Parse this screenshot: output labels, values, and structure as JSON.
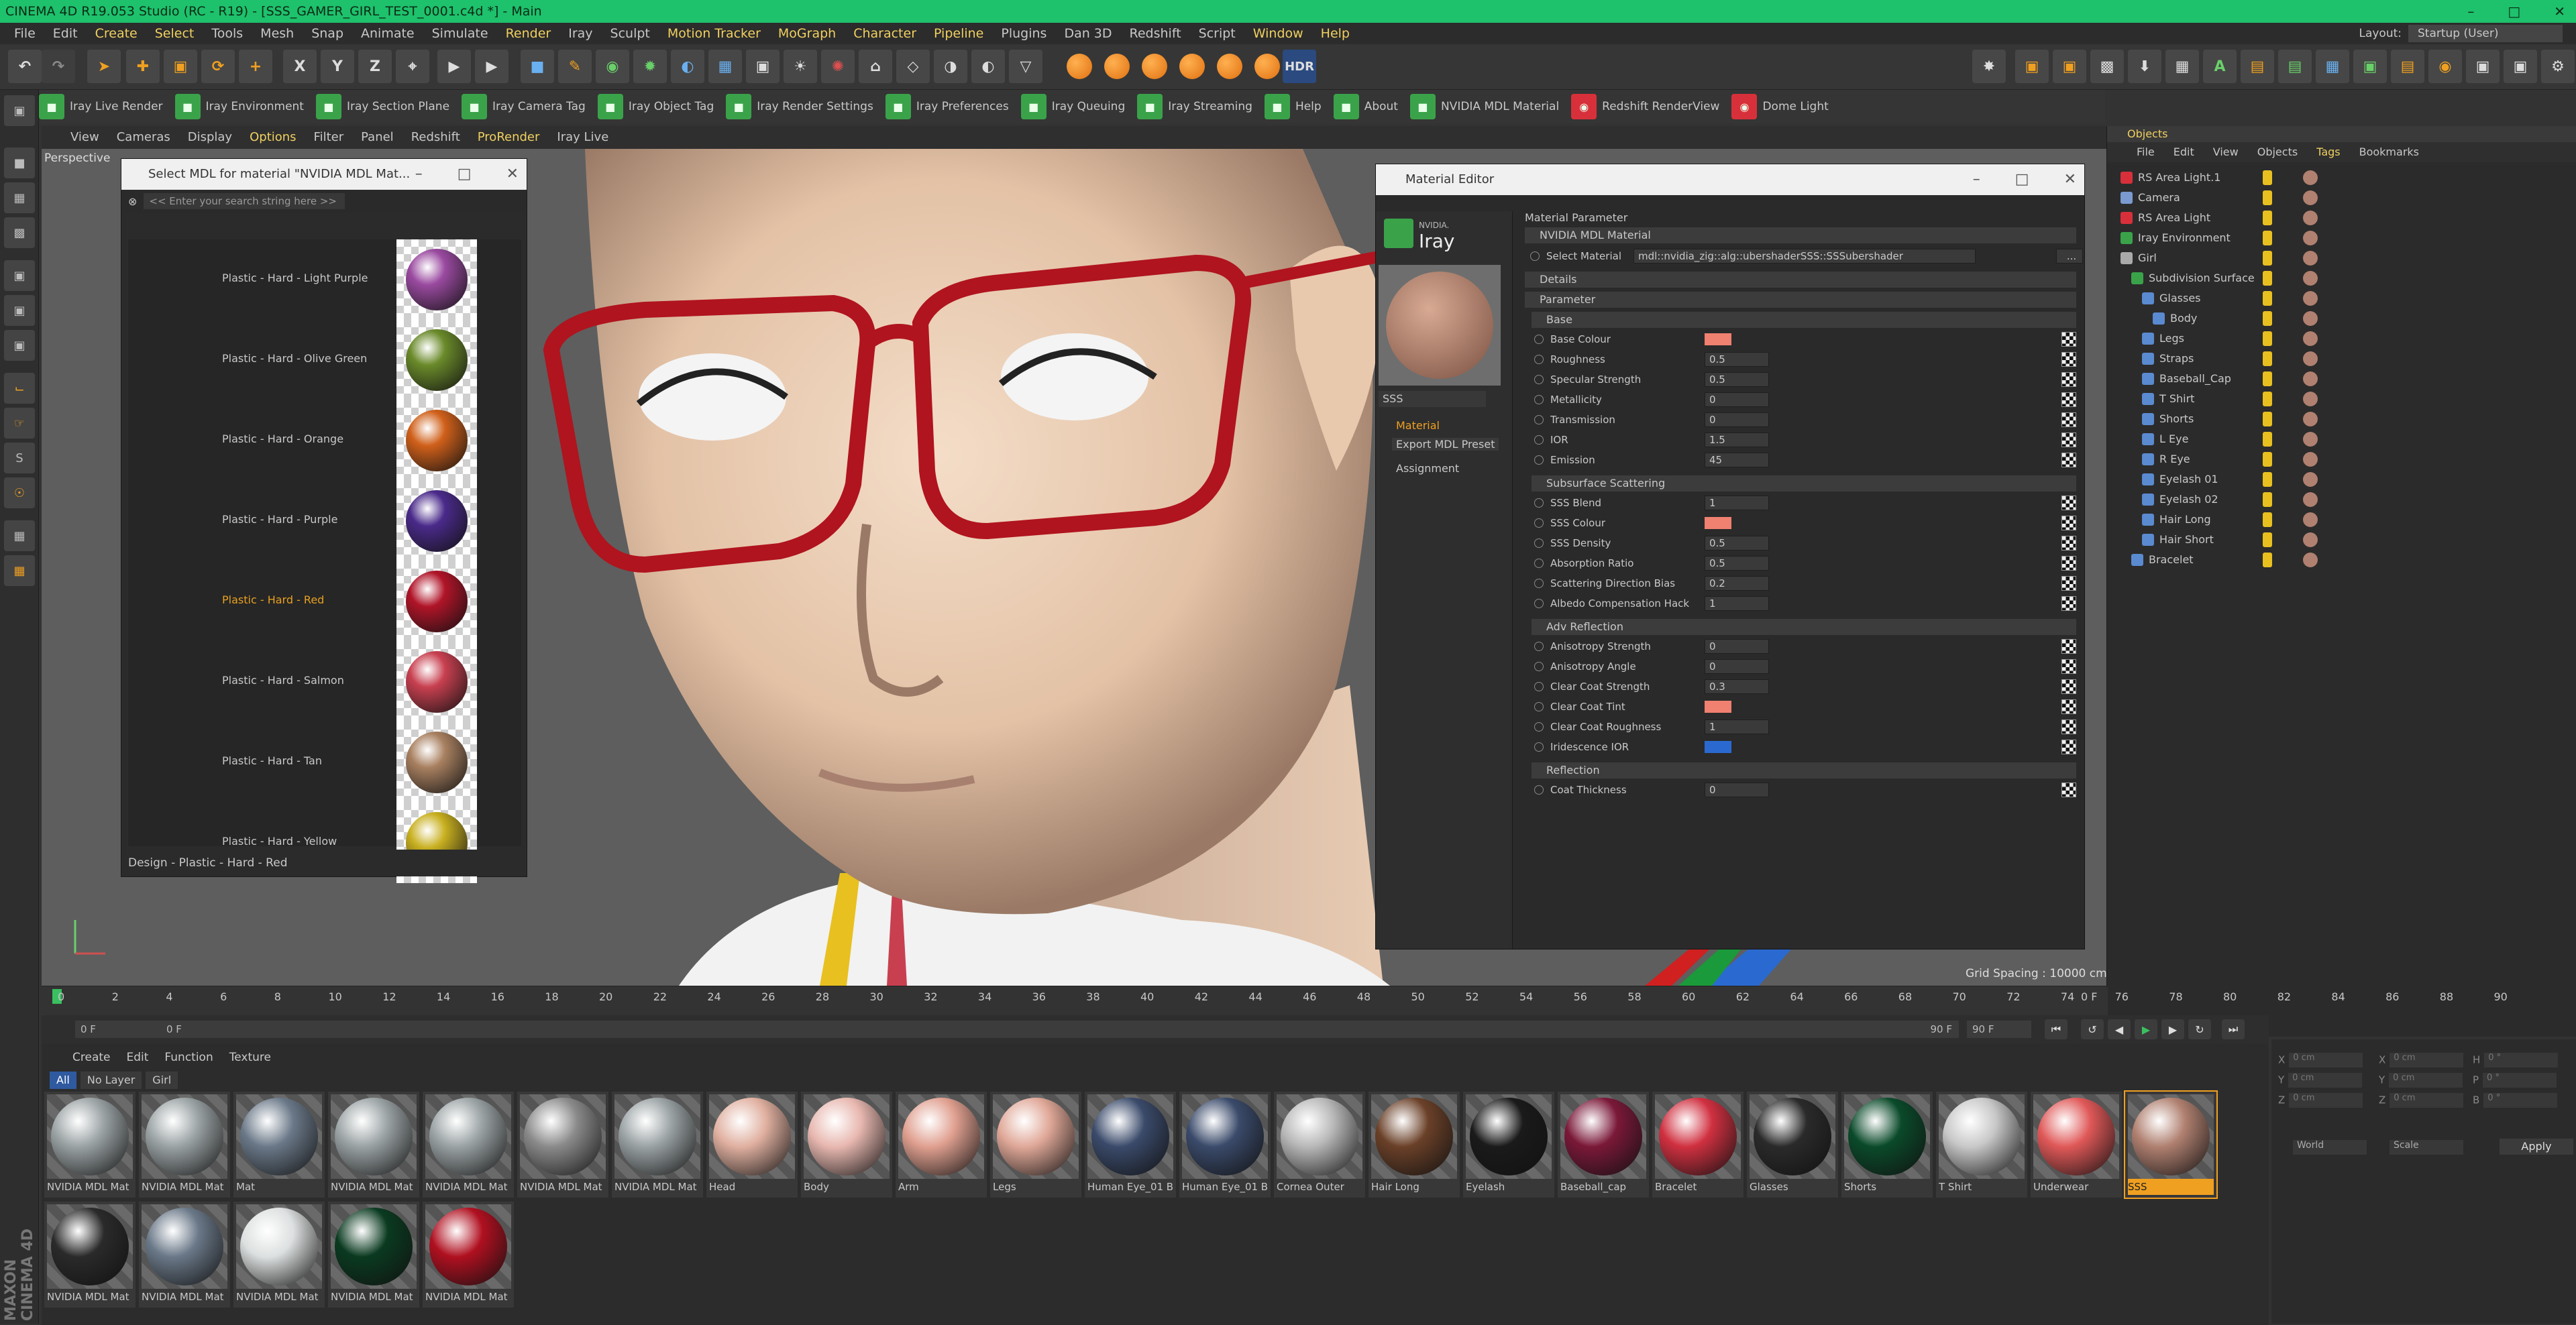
{
  "window": {
    "title": "CINEMA 4D R19.053 Studio (RC - R19) - [SSS_GAMER_GIRL_TEST_0001.c4d *] - Main"
  },
  "menubar": [
    "File",
    "Edit",
    "Create",
    "Select",
    "Tools",
    "Mesh",
    "Snap",
    "Animate",
    "Simulate",
    "Render",
    "Iray",
    "Sculpt",
    "Motion Tracker",
    "MoGraph",
    "Character",
    "Pipeline",
    "Plugins",
    "Dan 3D",
    "Redshift",
    "Script",
    "Window",
    "Help"
  ],
  "layout": {
    "label": "Layout:",
    "value": "Startup (User)"
  },
  "toolbar": {
    "hdr_label": "HDR"
  },
  "plugins": [
    {
      "label": "Iray Live Render",
      "icon": "iray-icon"
    },
    {
      "label": "Iray Environment",
      "icon": "iray-icon"
    },
    {
      "label": "Iray Section Plane",
      "icon": "iray-icon"
    },
    {
      "label": "Iray Camera Tag",
      "icon": "iray-icon"
    },
    {
      "label": "Iray Object Tag",
      "icon": "iray-icon"
    },
    {
      "label": "Iray Render Settings",
      "icon": "iray-icon"
    },
    {
      "label": "Iray Preferences",
      "icon": "iray-icon"
    },
    {
      "label": "Iray Queuing",
      "icon": "iray-icon"
    },
    {
      "label": "Iray Streaming",
      "icon": "iray-icon"
    },
    {
      "label": "Help",
      "icon": "iray-icon"
    },
    {
      "label": "About",
      "icon": "iray-icon"
    },
    {
      "label": "NVIDIA MDL Material",
      "icon": "iray-icon"
    },
    {
      "label": "Redshift RenderView",
      "icon": "redshift-icon"
    },
    {
      "label": "Dome Light",
      "icon": "redshift-icon"
    }
  ],
  "viewport": {
    "menu": [
      "View",
      "Cameras",
      "Display",
      "Options",
      "Filter",
      "Panel",
      "Redshift",
      "ProRender",
      "Iray Live"
    ],
    "label": "Perspective",
    "grid_spacing": "Grid Spacing : 10000 cm"
  },
  "mdl_browser": {
    "title": "Select MDL for material \"NVIDIA MDL Mat...",
    "search_placeholder": "<< Enter your search string here >>",
    "items": [
      {
        "label": "Plastic - Hard - Light Purple",
        "color": "#9a4aa0",
        "selected": false
      },
      {
        "label": "Plastic - Hard - Olive Green",
        "color": "#6a8a2a",
        "selected": false
      },
      {
        "label": "Plastic - Hard - Orange",
        "color": "#d0601a",
        "selected": false
      },
      {
        "label": "Plastic - Hard - Purple",
        "color": "#4a2a8a",
        "selected": false
      },
      {
        "label": "Plastic - Hard - Red",
        "color": "#b01428",
        "selected": true
      },
      {
        "label": "Plastic - Hard - Salmon",
        "color": "#c84050",
        "selected": false
      },
      {
        "label": "Plastic - Hard - Tan",
        "color": "#a88060",
        "selected": false
      },
      {
        "label": "Plastic - Hard - Yellow",
        "color": "#c8b020",
        "selected": false
      }
    ],
    "status": "Design - Plastic - Hard - Red"
  },
  "material_editor": {
    "title": "Material Editor",
    "logo_top": "NVIDIA.",
    "logo_text": "Iray",
    "material_name": "SSS",
    "channels": [
      "Material",
      "Export MDL Preset",
      "Assignment"
    ],
    "header": "Material Parameter",
    "mdl_section": "NVIDIA MDL Material",
    "select_material_label": "Select Material",
    "select_material_value": "mdl::nvidia_zig::alg::ubershaderSSS::SSSubershader",
    "browse_button": "...",
    "details_label": "Details",
    "parameter_label": "Parameter",
    "sections": [
      {
        "title": "Base",
        "params": [
          {
            "name": "Base Colour",
            "color": "#f08070"
          },
          {
            "name": "Roughness",
            "value": "0.5"
          },
          {
            "name": "Specular Strength",
            "value": "0.5"
          },
          {
            "name": "Metallicity",
            "value": "0"
          },
          {
            "name": "Transmission",
            "value": "0"
          },
          {
            "name": "IOR",
            "value": "1.5"
          },
          {
            "name": "Emission",
            "value": "45"
          }
        ]
      },
      {
        "title": "Subsurface Scattering",
        "params": [
          {
            "name": "SSS Blend",
            "value": "1"
          },
          {
            "name": "SSS Colour",
            "color": "#f08070"
          },
          {
            "name": "SSS Density",
            "value": "0.5"
          },
          {
            "name": "Absorption Ratio",
            "value": "0.5"
          },
          {
            "name": "Scattering Direction Bias",
            "value": "0.2"
          },
          {
            "name": "Albedo Compensation Hack",
            "value": "1"
          }
        ]
      },
      {
        "title": "Adv Reflection",
        "params": [
          {
            "name": "Anisotropy Strength",
            "value": "0"
          },
          {
            "name": "Anisotropy Angle",
            "value": "0"
          },
          {
            "name": "Clear Coat Strength",
            "value": "0.3"
          },
          {
            "name": "Clear Coat Tint",
            "color": "#f08070"
          },
          {
            "name": "Clear Coat Roughness",
            "value": "1"
          },
          {
            "name": "Iridescence IOR",
            "color": "#2a6ad0"
          }
        ]
      },
      {
        "title": "Reflection",
        "params": [
          {
            "name": "Coat Thickness",
            "value": "0"
          }
        ]
      }
    ]
  },
  "objects_panel": {
    "tab": "Objects",
    "menu": [
      "File",
      "Edit",
      "View",
      "Objects",
      "Tags",
      "Bookmarks"
    ],
    "items": [
      {
        "label": "RS Area Light.1",
        "depth": 0,
        "icon_color": "#d8303a"
      },
      {
        "label": "Camera",
        "depth": 0,
        "icon_color": "#7a9ad0"
      },
      {
        "label": "RS Area Light",
        "depth": 0,
        "icon_color": "#d8303a"
      },
      {
        "label": "Iray Environment",
        "depth": 0,
        "icon_color": "#3aa34a"
      },
      {
        "label": "Girl",
        "depth": 0,
        "icon_color": "#aaaaaa"
      },
      {
        "label": "Subdivision Surface",
        "depth": 1,
        "icon_color": "#3aa34a"
      },
      {
        "label": "Glasses",
        "depth": 2,
        "icon_color": "#5a8ad0"
      },
      {
        "label": "Body",
        "depth": 3,
        "icon_color": "#5a8ad0"
      },
      {
        "label": "Legs",
        "depth": 2,
        "icon_color": "#5a8ad0"
      },
      {
        "label": "Straps",
        "depth": 2,
        "icon_color": "#5a8ad0"
      },
      {
        "label": "Baseball_Cap",
        "depth": 2,
        "icon_color": "#5a8ad0"
      },
      {
        "label": "T Shirt",
        "depth": 2,
        "icon_color": "#5a8ad0"
      },
      {
        "label": "Shorts",
        "depth": 2,
        "icon_color": "#5a8ad0"
      },
      {
        "label": "L Eye",
        "depth": 2,
        "icon_color": "#5a8ad0"
      },
      {
        "label": "R Eye",
        "depth": 2,
        "icon_color": "#5a8ad0"
      },
      {
        "label": "Eyelash 01",
        "depth": 2,
        "icon_color": "#5a8ad0"
      },
      {
        "label": "Eyelash 02",
        "depth": 2,
        "icon_color": "#5a8ad0"
      },
      {
        "label": "Hair Long",
        "depth": 2,
        "icon_color": "#5a8ad0"
      },
      {
        "label": "Hair Short",
        "depth": 2,
        "icon_color": "#5a8ad0"
      },
      {
        "label": "Bracelet",
        "depth": 1,
        "icon_color": "#5a8ad0"
      }
    ]
  },
  "coordinates": {
    "rows": [
      {
        "a": "X",
        "av": "0 cm",
        "b": "X",
        "bv": "0 cm",
        "c": "H",
        "cv": "0 °"
      },
      {
        "a": "Y",
        "av": "0 cm",
        "b": "Y",
        "bv": "0 cm",
        "c": "P",
        "cv": "0 °"
      },
      {
        "a": "Z",
        "av": "0 cm",
        "b": "Z",
        "bv": "0 cm",
        "c": "B",
        "cv": "0 °"
      }
    ],
    "world": "World",
    "scale": "Scale",
    "apply": "Apply"
  },
  "timeline": {
    "ticks": [
      "0",
      "2",
      "4",
      "6",
      "8",
      "10",
      "12",
      "14",
      "16",
      "18",
      "20",
      "22",
      "24",
      "26",
      "28",
      "30",
      "32",
      "34",
      "36",
      "38",
      "40",
      "42",
      "44",
      "46",
      "48",
      "50",
      "52",
      "54",
      "56",
      "58",
      "60",
      "62",
      "64",
      "66",
      "68",
      "70",
      "72",
      "74",
      "76",
      "78",
      "80",
      "82",
      "84",
      "86",
      "88",
      "90"
    ],
    "end_label": "0 F",
    "current_frame": "0 F",
    "start_field": "0 F",
    "range_end": "90 F",
    "end_field": "90 F"
  },
  "material_manager": {
    "menu": [
      "Create",
      "Edit",
      "Function",
      "Texture"
    ],
    "filters": [
      "All",
      "No Layer",
      "Girl"
    ],
    "materials": [
      {
        "name": "NVIDIA MDL Mat",
        "color": "#9aa2a4"
      },
      {
        "name": "NVIDIA MDL Mat",
        "color": "#9aa2a4"
      },
      {
        "name": "Mat",
        "color": "#6a7888"
      },
      {
        "name": "NVIDIA MDL Mat",
        "color": "#9aa2a4"
      },
      {
        "name": "NVIDIA MDL Mat",
        "color": "#9aa2a4"
      },
      {
        "name": "NVIDIA MDL Mat",
        "color": "#8a8a8a"
      },
      {
        "name": "NVIDIA MDL Mat",
        "color": "#9aa2a4"
      },
      {
        "name": "Head",
        "color": "#e0b0a0"
      },
      {
        "name": "Body",
        "color": "#e8b8b0"
      },
      {
        "name": "Arm",
        "color": "#e0a090"
      },
      {
        "name": "Legs",
        "color": "#e0a898"
      },
      {
        "name": "Human Eye_01 Bl",
        "color": "#3a4a6a"
      },
      {
        "name": "Human Eye_01 Bl",
        "color": "#3a4a6a"
      },
      {
        "name": "Cornea Outer",
        "color": "#b8b8b8"
      },
      {
        "name": "Hair Long",
        "color": "#6a4028"
      },
      {
        "name": "Eyelash",
        "color": "#1a1a1a"
      },
      {
        "name": "Baseball_cap",
        "color": "#7a1838"
      },
      {
        "name": "Bracelet",
        "color": "#d03040"
      },
      {
        "name": "Glasses",
        "color": "#2a2a2a"
      },
      {
        "name": "Shorts",
        "color": "#0a4a2a"
      },
      {
        "name": "T Shirt",
        "color": "#c8c8c8"
      },
      {
        "name": "Underwear",
        "color": "#e05858"
      },
      {
        "name": "SSS",
        "color": "#b08070",
        "selected": true
      },
      {
        "name": "NVIDIA MDL Mat",
        "color": "#2a2a2a"
      },
      {
        "name": "NVIDIA MDL Mat",
        "color": "#6a7888"
      },
      {
        "name": "NVIDIA MDL Mat",
        "color": "#dde0e0"
      },
      {
        "name": "NVIDIA MDL Mat",
        "color": "#0a3a20"
      },
      {
        "name": "NVIDIA MDL Mat",
        "color": "#b01020"
      }
    ]
  },
  "branding": {
    "logo": "MAXON CINEMA 4D"
  }
}
